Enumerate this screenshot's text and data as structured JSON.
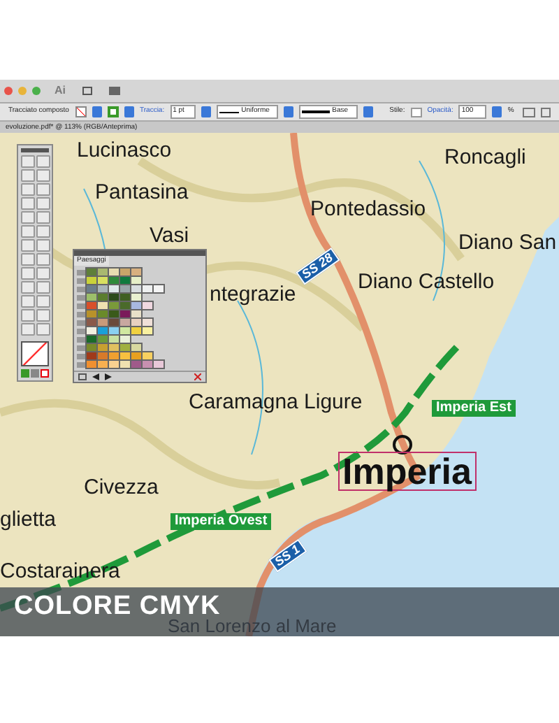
{
  "app": {
    "logo": "Ai"
  },
  "control_bar": {
    "object_type": "Tracciato composto",
    "stroke_label": "Traccia:",
    "stroke_weight": "1 pt",
    "profile": "Uniforme",
    "brush": "Base",
    "style_label": "Stile:",
    "opacity_label": "Opacità:",
    "opacity": "100",
    "percent": "%"
  },
  "document_tab": {
    "title": "evoluzione.pdf* @ 113% (RGB/Anteprima)"
  },
  "map": {
    "labels": [
      {
        "text": "Lucinasco",
        "kind": "town"
      },
      {
        "text": "Roncagli",
        "kind": "town"
      },
      {
        "text": "Pantasina",
        "kind": "town"
      },
      {
        "text": "Vasi",
        "kind": "town"
      },
      {
        "text": "Pontedassio",
        "kind": "town"
      },
      {
        "text": "Diano San",
        "kind": "town"
      },
      {
        "text": "SS 28",
        "kind": "shield"
      },
      {
        "text": "ntegrazie",
        "kind": "town"
      },
      {
        "text": "Diano Castello",
        "kind": "town"
      },
      {
        "text": "Imperia Est",
        "kind": "exit"
      },
      {
        "text": "Caramagna Ligure",
        "kind": "town"
      },
      {
        "text": "Imperia",
        "kind": "city"
      },
      {
        "text": "Civezza",
        "kind": "town"
      },
      {
        "text": "glietta",
        "kind": "town"
      },
      {
        "text": "Imperia Ovest",
        "kind": "exit"
      },
      {
        "text": "SS 1",
        "kind": "shield"
      },
      {
        "text": "Costarainera",
        "kind": "town"
      },
      {
        "text": "San Lorenzo al Mare",
        "kind": "town"
      }
    ]
  },
  "swatches_panel": {
    "tab": "Paesaggi",
    "rows": [
      {
        "swatches": [
          {
            "color": "#5e7f3a"
          },
          {
            "color": "#a9b870"
          },
          {
            "color": "#e8dcb0"
          },
          {
            "color": "#c8a56a"
          },
          {
            "color": "#d8b080"
          }
        ]
      },
      {
        "swatches": [
          {
            "color": "#c9d23a"
          },
          {
            "color": "#d8e060"
          },
          {
            "color": "#2f8a3a"
          },
          {
            "color": "#0f7a3e"
          },
          {
            "color": "#e6efc8"
          }
        ]
      },
      {
        "swatches": [
          {
            "color": "#6b7d8a"
          },
          {
            "color": "#a8b4b8"
          },
          {
            "color": "#e0e8ea"
          },
          {
            "color": "#9aa6aa"
          },
          {
            "color": "#d8dde0"
          },
          {
            "color": "#eef0f0"
          },
          {
            "color": "#f4f4f4"
          }
        ]
      },
      {
        "swatches": [
          {
            "color": "#9cbf6a"
          },
          {
            "color": "#5a7d2e"
          },
          {
            "color": "#2c4a1a"
          },
          {
            "color": "#3f5f22"
          },
          {
            "color": "#e8f0d0"
          }
        ]
      },
      {
        "swatches": [
          {
            "color": "#d94f2a"
          },
          {
            "color": "#f0e0b0"
          },
          {
            "color": "#7a9a3a"
          },
          {
            "color": "#4a6a2a"
          },
          {
            "color": "#a8b8e0"
          },
          {
            "color": "#f0d8e0"
          }
        ]
      },
      {
        "swatches": [
          {
            "color": "#b8922a"
          },
          {
            "color": "#6a8a2a"
          },
          {
            "color": "#3a5a1a"
          },
          {
            "color": "#7a1a5a"
          },
          {
            "color": "#e8e0c8"
          }
        ]
      },
      {
        "swatches": [
          {
            "color": "#8a5a4a"
          },
          {
            "color": "#c89a7a"
          },
          {
            "color": "#6a4a3a"
          },
          {
            "color": "#c8a8a0"
          },
          {
            "color": "#e8d0c0"
          },
          {
            "color": "#f0e0d8"
          }
        ]
      },
      {
        "swatches": [
          {
            "color": "#f0f0e0"
          },
          {
            "color": "#1aa0d8"
          },
          {
            "color": "#8ad0f0"
          },
          {
            "color": "#d0e8a0"
          },
          {
            "color": "#f0d040"
          },
          {
            "color": "#f8f0a0"
          }
        ]
      },
      {
        "swatches": [
          {
            "color": "#1a6a2a"
          },
          {
            "color": "#6a9a3a"
          },
          {
            "color": "#c8e0a0"
          },
          {
            "color": "#e8f0d8"
          }
        ]
      },
      {
        "swatches": [
          {
            "color": "#7a8a2a"
          },
          {
            "color": "#c8a030"
          },
          {
            "color": "#e0c060"
          },
          {
            "color": "#a0b040"
          },
          {
            "color": "#d8d8a0"
          }
        ]
      },
      {
        "swatches": [
          {
            "color": "#a03a1a"
          },
          {
            "color": "#d87a2a"
          },
          {
            "color": "#f0a030"
          },
          {
            "color": "#f8c040"
          },
          {
            "color": "#e8a020"
          },
          {
            "color": "#f8d060"
          }
        ]
      },
      {
        "swatches": [
          {
            "color": "#f09030"
          },
          {
            "color": "#f8b050"
          },
          {
            "color": "#f8d090"
          },
          {
            "color": "#f0e0b0"
          },
          {
            "color": "#a05a8a"
          },
          {
            "color": "#c890b0"
          },
          {
            "color": "#e8c8d8"
          }
        ]
      }
    ]
  },
  "banner": {
    "text": "COLORE CMYK"
  }
}
